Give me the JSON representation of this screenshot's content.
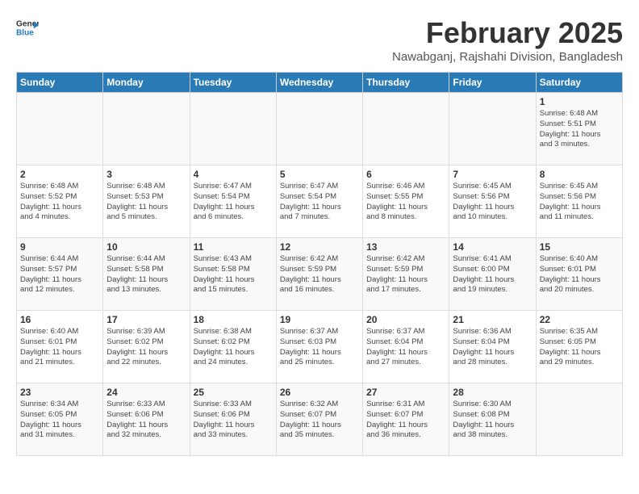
{
  "logo": {
    "text_general": "General",
    "text_blue": "Blue"
  },
  "title": "February 2025",
  "subtitle": "Nawabganj, Rajshahi Division, Bangladesh",
  "days_of_week": [
    "Sunday",
    "Monday",
    "Tuesday",
    "Wednesday",
    "Thursday",
    "Friday",
    "Saturday"
  ],
  "weeks": [
    [
      {
        "day": "",
        "info": ""
      },
      {
        "day": "",
        "info": ""
      },
      {
        "day": "",
        "info": ""
      },
      {
        "day": "",
        "info": ""
      },
      {
        "day": "",
        "info": ""
      },
      {
        "day": "",
        "info": ""
      },
      {
        "day": "1",
        "info": "Sunrise: 6:48 AM\nSunset: 5:51 PM\nDaylight: 11 hours\nand 3 minutes."
      }
    ],
    [
      {
        "day": "2",
        "info": "Sunrise: 6:48 AM\nSunset: 5:52 PM\nDaylight: 11 hours\nand 4 minutes."
      },
      {
        "day": "3",
        "info": "Sunrise: 6:48 AM\nSunset: 5:53 PM\nDaylight: 11 hours\nand 5 minutes."
      },
      {
        "day": "4",
        "info": "Sunrise: 6:47 AM\nSunset: 5:54 PM\nDaylight: 11 hours\nand 6 minutes."
      },
      {
        "day": "5",
        "info": "Sunrise: 6:47 AM\nSunset: 5:54 PM\nDaylight: 11 hours\nand 7 minutes."
      },
      {
        "day": "6",
        "info": "Sunrise: 6:46 AM\nSunset: 5:55 PM\nDaylight: 11 hours\nand 8 minutes."
      },
      {
        "day": "7",
        "info": "Sunrise: 6:45 AM\nSunset: 5:56 PM\nDaylight: 11 hours\nand 10 minutes."
      },
      {
        "day": "8",
        "info": "Sunrise: 6:45 AM\nSunset: 5:56 PM\nDaylight: 11 hours\nand 11 minutes."
      }
    ],
    [
      {
        "day": "9",
        "info": "Sunrise: 6:44 AM\nSunset: 5:57 PM\nDaylight: 11 hours\nand 12 minutes."
      },
      {
        "day": "10",
        "info": "Sunrise: 6:44 AM\nSunset: 5:58 PM\nDaylight: 11 hours\nand 13 minutes."
      },
      {
        "day": "11",
        "info": "Sunrise: 6:43 AM\nSunset: 5:58 PM\nDaylight: 11 hours\nand 15 minutes."
      },
      {
        "day": "12",
        "info": "Sunrise: 6:42 AM\nSunset: 5:59 PM\nDaylight: 11 hours\nand 16 minutes."
      },
      {
        "day": "13",
        "info": "Sunrise: 6:42 AM\nSunset: 5:59 PM\nDaylight: 11 hours\nand 17 minutes."
      },
      {
        "day": "14",
        "info": "Sunrise: 6:41 AM\nSunset: 6:00 PM\nDaylight: 11 hours\nand 19 minutes."
      },
      {
        "day": "15",
        "info": "Sunrise: 6:40 AM\nSunset: 6:01 PM\nDaylight: 11 hours\nand 20 minutes."
      }
    ],
    [
      {
        "day": "16",
        "info": "Sunrise: 6:40 AM\nSunset: 6:01 PM\nDaylight: 11 hours\nand 21 minutes."
      },
      {
        "day": "17",
        "info": "Sunrise: 6:39 AM\nSunset: 6:02 PM\nDaylight: 11 hours\nand 22 minutes."
      },
      {
        "day": "18",
        "info": "Sunrise: 6:38 AM\nSunset: 6:02 PM\nDaylight: 11 hours\nand 24 minutes."
      },
      {
        "day": "19",
        "info": "Sunrise: 6:37 AM\nSunset: 6:03 PM\nDaylight: 11 hours\nand 25 minutes."
      },
      {
        "day": "20",
        "info": "Sunrise: 6:37 AM\nSunset: 6:04 PM\nDaylight: 11 hours\nand 27 minutes."
      },
      {
        "day": "21",
        "info": "Sunrise: 6:36 AM\nSunset: 6:04 PM\nDaylight: 11 hours\nand 28 minutes."
      },
      {
        "day": "22",
        "info": "Sunrise: 6:35 AM\nSunset: 6:05 PM\nDaylight: 11 hours\nand 29 minutes."
      }
    ],
    [
      {
        "day": "23",
        "info": "Sunrise: 6:34 AM\nSunset: 6:05 PM\nDaylight: 11 hours\nand 31 minutes."
      },
      {
        "day": "24",
        "info": "Sunrise: 6:33 AM\nSunset: 6:06 PM\nDaylight: 11 hours\nand 32 minutes."
      },
      {
        "day": "25",
        "info": "Sunrise: 6:33 AM\nSunset: 6:06 PM\nDaylight: 11 hours\nand 33 minutes."
      },
      {
        "day": "26",
        "info": "Sunrise: 6:32 AM\nSunset: 6:07 PM\nDaylight: 11 hours\nand 35 minutes."
      },
      {
        "day": "27",
        "info": "Sunrise: 6:31 AM\nSunset: 6:07 PM\nDaylight: 11 hours\nand 36 minutes."
      },
      {
        "day": "28",
        "info": "Sunrise: 6:30 AM\nSunset: 6:08 PM\nDaylight: 11 hours\nand 38 minutes."
      },
      {
        "day": "",
        "info": ""
      }
    ]
  ]
}
